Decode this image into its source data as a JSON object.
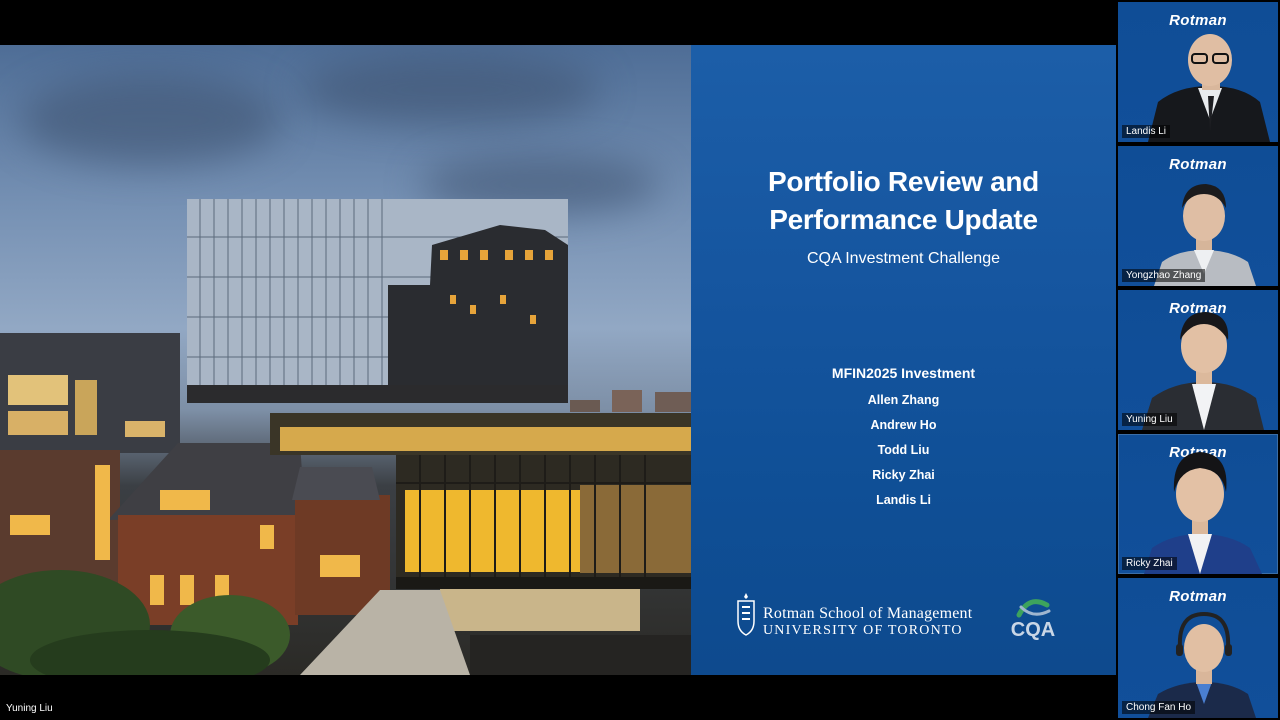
{
  "slide": {
    "title_line1": "Portfolio Review and",
    "title_line2": "Performance Update",
    "subtitle": "CQA Investment Challenge",
    "team_heading": "MFIN2025 Investment",
    "team_members": [
      "Allen Zhang",
      "Andrew Ho",
      "Todd Liu",
      "Ricky Zhai",
      "Landis Li"
    ],
    "school_line1": "Rotman School of Management",
    "school_line2": "UNIVERSITY OF TORONTO",
    "partner_logo_text": "CQA"
  },
  "presenter": {
    "name": "Yuning Liu"
  },
  "participants": [
    {
      "name": "Landis Li",
      "brand": "Rotman"
    },
    {
      "name": "Yongzhao Zhang",
      "brand": "Rotman"
    },
    {
      "name": "Yuning Liu",
      "brand": "Rotman"
    },
    {
      "name": "Ricky Zhai",
      "brand": "Rotman"
    },
    {
      "name": "Chong Fan Ho",
      "brand": "Rotman"
    }
  ],
  "colors": {
    "slide_blue": "#15559f",
    "tile_blue": "#0f4d96",
    "background": "#000000",
    "window_glow": "#f2b530"
  },
  "icons": [
    "university-crest-icon",
    "cqa-swoosh-icon"
  ]
}
